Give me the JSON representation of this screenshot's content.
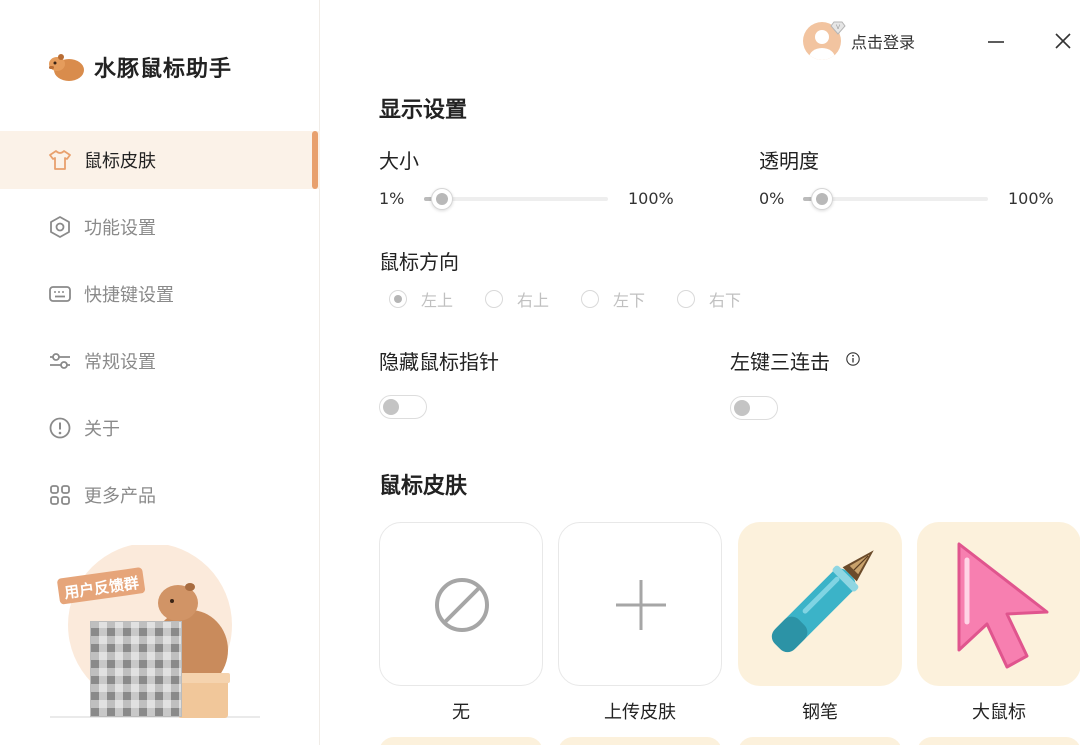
{
  "app": {
    "name": "水豚鼠标助手"
  },
  "header": {
    "login_label": "点击登录"
  },
  "sidebar": {
    "items": [
      {
        "label": "鼠标皮肤",
        "icon": "shirt-icon",
        "active": true
      },
      {
        "label": "功能设置",
        "icon": "hexagon-settings-icon",
        "active": false
      },
      {
        "label": "快捷键设置",
        "icon": "keyboard-icon",
        "active": false
      },
      {
        "label": "常规设置",
        "icon": "sliders-icon",
        "active": false
      },
      {
        "label": "关于",
        "icon": "info-circle-icon",
        "active": false
      },
      {
        "label": "更多产品",
        "icon": "grid-icon",
        "active": false
      }
    ],
    "feedback_label": "用户反馈群"
  },
  "display": {
    "title": "显示设置",
    "size": {
      "label": "大小",
      "min_label": "1%",
      "max_label": "100%",
      "value_fraction": 0.1
    },
    "opacity": {
      "label": "透明度",
      "min_label": "0%",
      "max_label": "100%",
      "value_fraction": 0.1
    },
    "direction": {
      "label": "鼠标方向",
      "options": [
        "左上",
        "右上",
        "左下",
        "右下"
      ],
      "selected": "左上"
    },
    "hide_pointer": {
      "label": "隐藏鼠标指针",
      "on": false
    },
    "triple_click": {
      "label": "左键三连击",
      "on": false
    }
  },
  "skins": {
    "title": "鼠标皮肤",
    "items": [
      {
        "label": "无",
        "icon": "none-icon"
      },
      {
        "label": "上传皮肤",
        "icon": "plus-icon"
      },
      {
        "label": "钢笔",
        "icon": "fountain-pen-icon"
      },
      {
        "label": "大鼠标",
        "icon": "pink-cursor-icon"
      }
    ]
  },
  "colors": {
    "accent": "#e8a06d",
    "active_bg": "#fbf2e8",
    "skin_bg": "#fcf1dc",
    "cursor_pink": "#f77fb0",
    "pen_teal": "#3bb3c8"
  }
}
